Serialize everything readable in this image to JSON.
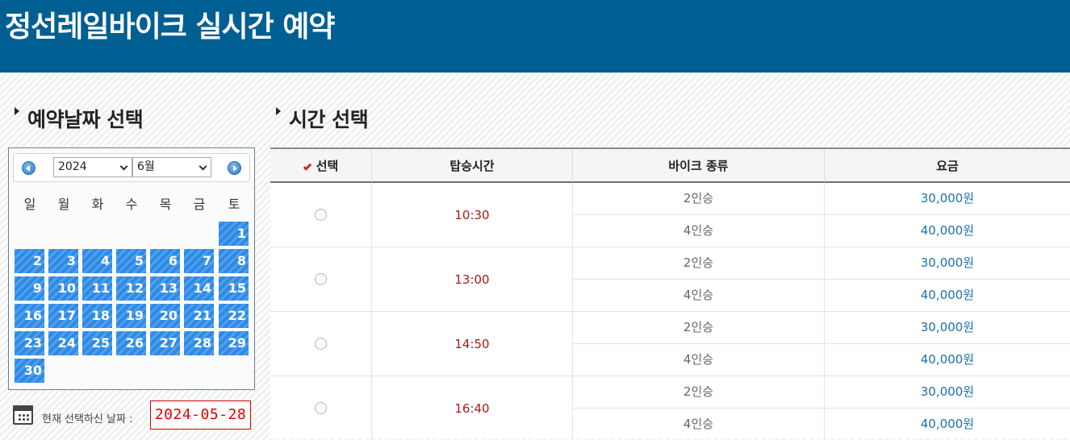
{
  "header": {
    "title": "정선레일바이크 실시간 예약"
  },
  "sections": {
    "date_title": "예약날짜 선택",
    "time_title": "시간 선택"
  },
  "calendar": {
    "year": "2024",
    "month": "6월",
    "weekdays": [
      "일",
      "월",
      "화",
      "수",
      "목",
      "금",
      "토"
    ],
    "days": [
      "1",
      "2",
      "3",
      "4",
      "5",
      "6",
      "7",
      "8",
      "9",
      "10",
      "11",
      "12",
      "13",
      "14",
      "15",
      "16",
      "17",
      "18",
      "19",
      "20",
      "21",
      "22",
      "23",
      "24",
      "25",
      "26",
      "27",
      "28",
      "29",
      "30"
    ],
    "first_weekday_index": 6,
    "day_color": "#2c8ae6"
  },
  "current_date": {
    "label": "현재 선택하신 날짜 :",
    "value": "2024-05-28"
  },
  "table": {
    "headers": [
      "선택",
      "탑승시간",
      "바이크 종류",
      "요금"
    ],
    "slots": [
      {
        "time": "10:30",
        "options": [
          {
            "bike": "2인승",
            "price": "30,000원"
          },
          {
            "bike": "4인승",
            "price": "40,000원"
          }
        ]
      },
      {
        "time": "13:00",
        "options": [
          {
            "bike": "2인승",
            "price": "30,000원"
          },
          {
            "bike": "4인승",
            "price": "40,000원"
          }
        ]
      },
      {
        "time": "14:50",
        "options": [
          {
            "bike": "2인승",
            "price": "30,000원"
          },
          {
            "bike": "4인승",
            "price": "40,000원"
          }
        ]
      },
      {
        "time": "16:40",
        "options": [
          {
            "bike": "2인승",
            "price": "30,000원"
          },
          {
            "bike": "4인승",
            "price": "40,000원"
          }
        ]
      }
    ]
  },
  "colors": {
    "header_bg": "#005f92",
    "time_text": "#a41c1c",
    "price_text": "#1a70b0",
    "selected_date": "#e00000"
  }
}
